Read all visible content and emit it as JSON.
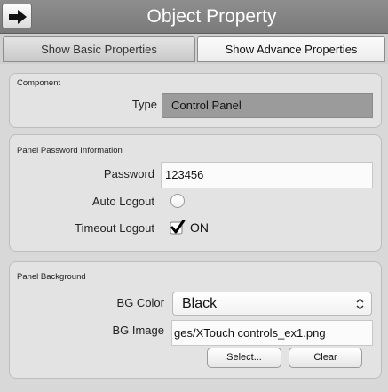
{
  "window": {
    "title": "Object Property"
  },
  "icons": {
    "back": "right-arrow-icon",
    "checkbox": "checkmark-icon",
    "select": "up-down-chevron-icon"
  },
  "tabs": [
    {
      "label": "Show Basic Properties",
      "active": false
    },
    {
      "label": "Show Advance Properties",
      "active": true
    }
  ],
  "component": {
    "heading": "Component",
    "type_label": "Type",
    "type_value": "Control Panel"
  },
  "password_info": {
    "heading": "Panel Password Information",
    "password_label": "Password",
    "password_value": "123456",
    "auto_logout_label": "Auto Logout",
    "auto_logout_checked": false,
    "timeout_logout_label": "Timeout Logout",
    "timeout_logout_checked": true,
    "timeout_on_label": "ON"
  },
  "background": {
    "heading": "Panel Background",
    "bg_color_label": "BG Color",
    "bg_color_value": "Black",
    "bg_image_label": "BG Image",
    "bg_image_value": "ges/XTouch controls_ex1.png",
    "select_button": "Select...",
    "clear_button": "Clear"
  },
  "colors": {
    "title_bar": "#858585",
    "type_field": "#9b9b9b",
    "panel": "#e3e3e3"
  }
}
